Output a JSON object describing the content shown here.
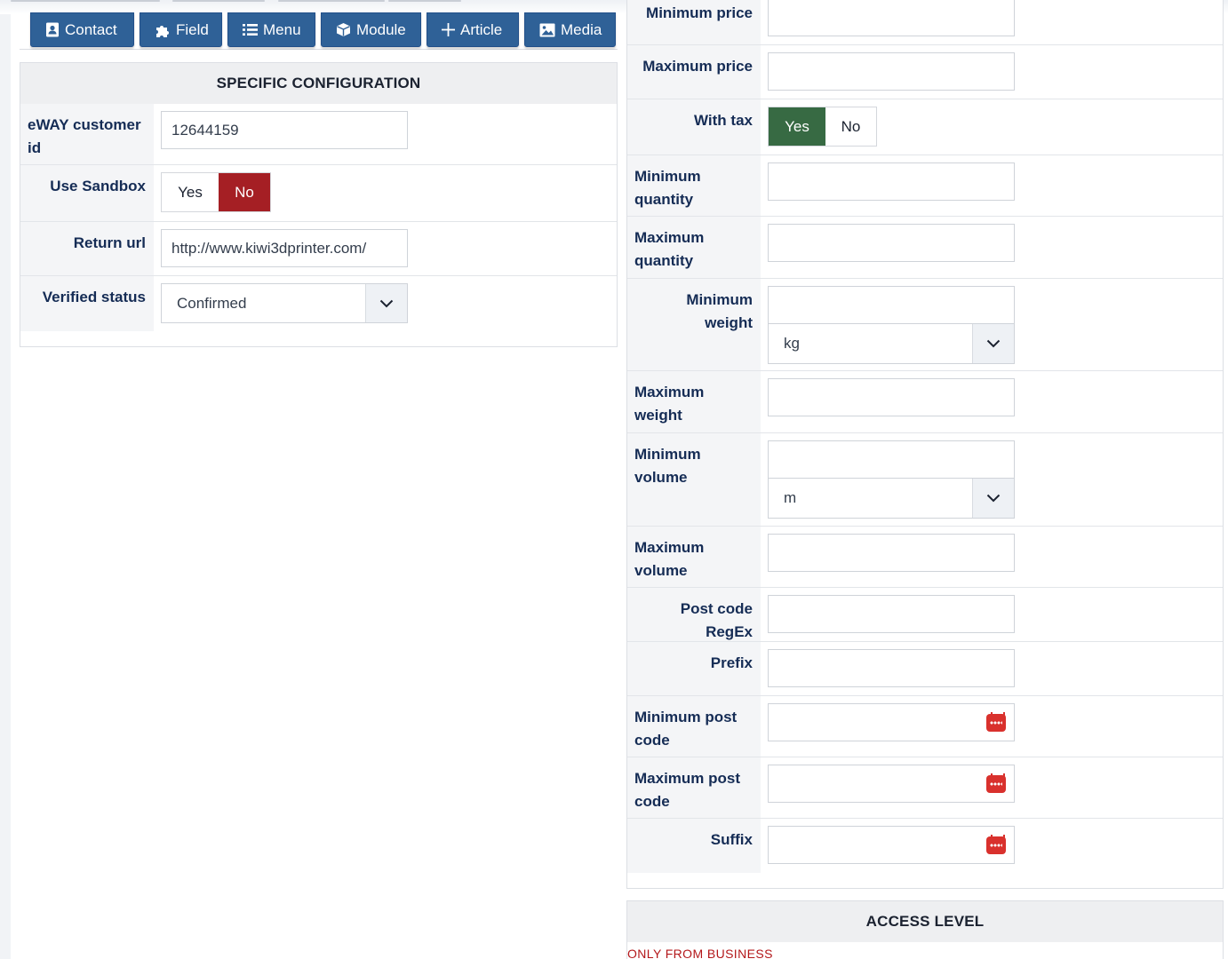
{
  "toolbar": {
    "buttons": [
      {
        "label": "Contact",
        "icon": "contact-card-icon"
      },
      {
        "label": "Field",
        "icon": "puzzle-piece-icon"
      },
      {
        "label": "Menu",
        "icon": "list-icon"
      },
      {
        "label": "Module",
        "icon": "cube-icon"
      },
      {
        "label": "Article",
        "icon": "plus-icon"
      },
      {
        "label": "Media",
        "icon": "image-icon"
      }
    ]
  },
  "specific_config": {
    "title": "SPECIFIC CONFIGURATION",
    "eway_customer_id": {
      "label": "eWAY customer id",
      "value": "12644159"
    },
    "use_sandbox": {
      "label": "Use Sandbox",
      "yes": "Yes",
      "no": "No",
      "selected": "No"
    },
    "return_url": {
      "label": "Return url",
      "value": "http://www.kiwi3dprinter.com/"
    },
    "verified_status": {
      "label": "Verified status",
      "value": "Confirmed"
    }
  },
  "restrictions": {
    "minimum_price": {
      "label": "Minimum price",
      "value": ""
    },
    "maximum_price": {
      "label": "Maximum price",
      "value": ""
    },
    "with_tax": {
      "label": "With tax",
      "yes": "Yes",
      "no": "No",
      "selected": "Yes"
    },
    "minimum_quantity": {
      "label": "Minimum quantity",
      "value": ""
    },
    "maximum_quantity": {
      "label": "Maximum quantity",
      "value": ""
    },
    "minimum_weight": {
      "label": "Minimum weight",
      "value": "",
      "unit": "kg"
    },
    "maximum_weight": {
      "label": "Maximum weight",
      "value": ""
    },
    "minimum_volume": {
      "label": "Minimum volume",
      "value": "",
      "unit": "m"
    },
    "maximum_volume": {
      "label": "Maximum volume",
      "value": ""
    },
    "post_code_regex": {
      "label": "Post code RegEx",
      "value": ""
    },
    "prefix": {
      "label": "Prefix",
      "value": ""
    },
    "minimum_post_code": {
      "label": "Minimum post code",
      "value": ""
    },
    "maximum_post_code": {
      "label": "Maximum post code",
      "value": ""
    },
    "suffix": {
      "label": "Suffix",
      "value": ""
    }
  },
  "access_level": {
    "title": "ACCESS LEVEL",
    "text": "ONLY FROM BUSINESS"
  },
  "colors": {
    "toolbar_button": "#2f6197",
    "sandbox_no_active": "#a51f24",
    "with_tax_yes_active": "#376a43",
    "label_text": "#152c55",
    "date_icon": "#d9312d"
  }
}
